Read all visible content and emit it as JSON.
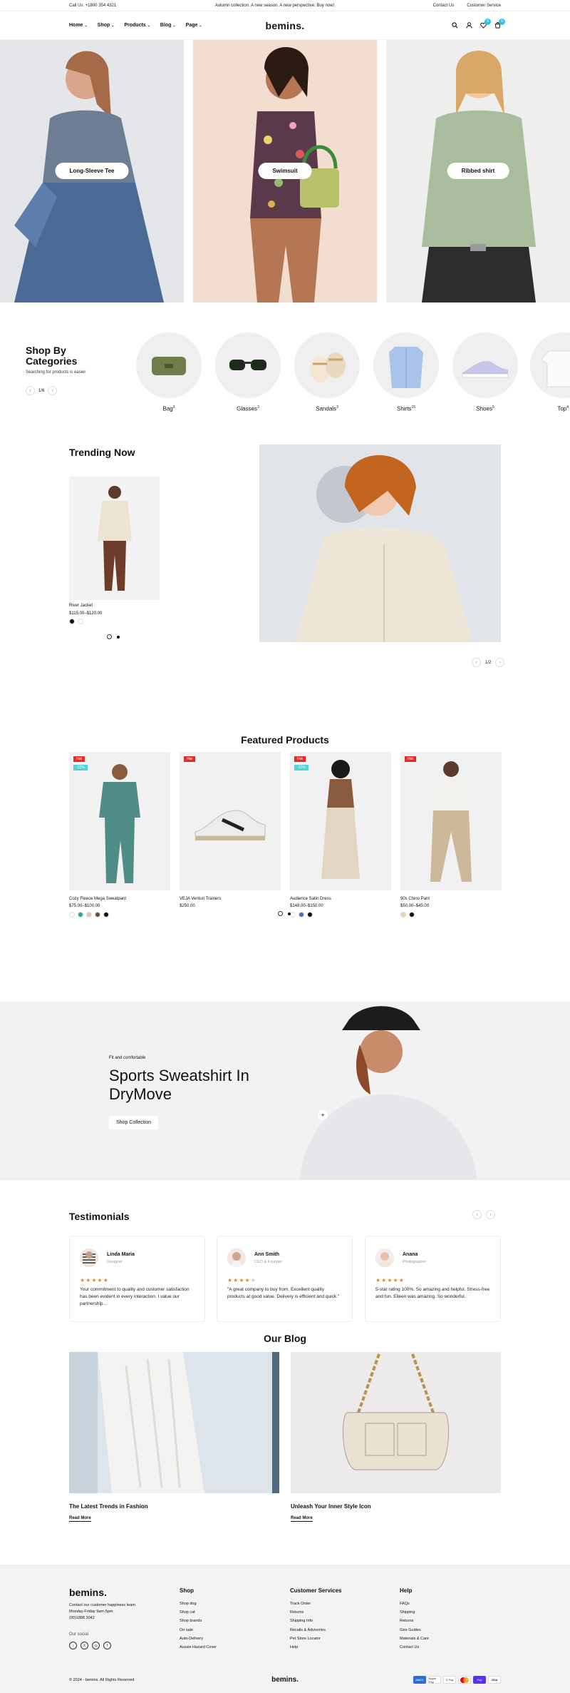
{
  "topbar": {
    "call": "Call Us: +1800 354 4321",
    "announcement": "Autumn collection. A new season. A new perspective. Buy now!",
    "contact": "Contact Us",
    "service": "Customer Service"
  },
  "header": {
    "nav": [
      "Home",
      "Shop",
      "Products",
      "Blog",
      "Page"
    ],
    "logo": "bemins.",
    "wishlist_count": "0",
    "cart_count": "0"
  },
  "hero": [
    {
      "label": "Long-Sleeve Tee"
    },
    {
      "label": "Swimsuit"
    },
    {
      "label": "Ribbed shirt"
    }
  ],
  "categories": {
    "title": "Shop By Categories",
    "subtitle": "Searching for products is easier",
    "pager": "1/6",
    "items": [
      {
        "name": "Bag",
        "count": "3"
      },
      {
        "name": "Glasses",
        "count": "3"
      },
      {
        "name": "Sandals",
        "count": "3"
      },
      {
        "name": "Shirts",
        "count": "15"
      },
      {
        "name": "Shoes",
        "count": "5"
      },
      {
        "name": "Top",
        "count": "4"
      }
    ]
  },
  "trending": {
    "title": "Trending Now",
    "product": {
      "name": "River Jacket",
      "price": "$115.00–$120.00"
    },
    "pager": "1/2"
  },
  "featured": {
    "title": "Featured Products",
    "products": [
      {
        "name": "Cozy Fleece Mega Sweatpant",
        "price": "$75.00–$100.00",
        "hot": "Hot",
        "off": "-22%"
      },
      {
        "name": "VEJA Venturi Trainers",
        "price": "$250.00",
        "hot": "Hot",
        "off": ""
      },
      {
        "name": "Audience Satin Dress",
        "price": "$148.00–$150.00",
        "hot": "Hot",
        "off": "-32%"
      },
      {
        "name": "90s Chino Pant",
        "price": "$50.00–$45.00",
        "hot": "Hot",
        "off": ""
      }
    ]
  },
  "promo": {
    "eyebrow": "Fit and comfortable",
    "title": "Sports Sweatshirt In DryMove",
    "button": "Shop Collection"
  },
  "testimonials": {
    "title": "Testimonials",
    "items": [
      {
        "name": "Linda Maria",
        "role": "Designer",
        "rating": 5,
        "quote": "Your commitment to quality and customer satisfaction has been evident in every interaction. I value our partnership..."
      },
      {
        "name": "Ann Smith",
        "role": "CEO & Founder",
        "rating": 4,
        "quote": "\"A great company to buy from. Excellent quality products at good value. Delivery is efficient and quick.\""
      },
      {
        "name": "Anana",
        "role": "Photographer",
        "rating": 5,
        "quote": "5-star rating 100%. So amazing and helpful. Stress-free and fun. Eileen was amazing. So wonderful."
      }
    ]
  },
  "blog": {
    "title": "Our Blog",
    "posts": [
      {
        "title": "The Latest Trends in Fashion",
        "more": "Read More"
      },
      {
        "title": "Unleash Your Inner Style Icon",
        "more": "Read More"
      }
    ]
  },
  "footer": {
    "logo": "bemins.",
    "contact_line1": "Contact our customer happiness team",
    "contact_line2": "Monday-Friday 9am-5pm",
    "contact_line3": "(00)1888 3042",
    "social_label": "Our social",
    "shop": {
      "title": "Shop",
      "links": [
        "Shop dog",
        "Shop cat",
        "Shop brands",
        "On sale",
        "Auto-Delivery",
        "Aussie Hazard Cover"
      ]
    },
    "service": {
      "title": "Customer Services",
      "links": [
        "Track Order",
        "Returns",
        "Shipping Info",
        "Recalls & Advisories",
        "Pet Store Locator",
        "Help"
      ]
    },
    "help": {
      "title": "Help",
      "links": [
        "FAQs",
        "Shipping",
        "Returns",
        "Size Guides",
        "Materials & Care",
        "Contact Us"
      ]
    },
    "copyright": "© 2024 - bemins. All Rights Reserved",
    "logo_small": "bemins.",
    "payments": [
      "AMEX",
      "Apple Pay",
      "G Pay",
      "MC",
      "Pay",
      "VISA"
    ]
  },
  "colors": {
    "accent": "#33c3d9",
    "hot": "#e52a2a",
    "off": "#52d3d8",
    "star": "#e8891d"
  }
}
